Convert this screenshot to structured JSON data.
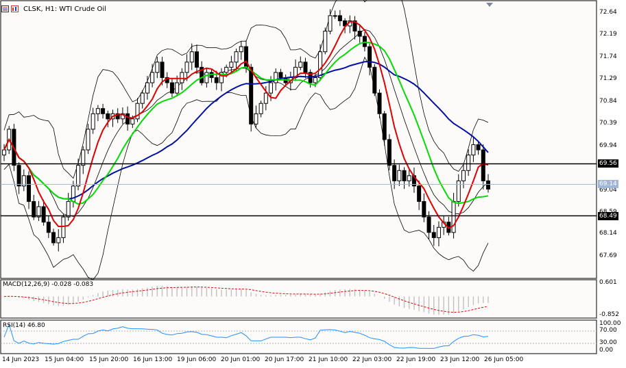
{
  "header": {
    "symbol": "CLSK",
    "timeframe": "H1",
    "instrument": "WTI Crude Oil",
    "title": "CLSK, H1:  WTI Crude Oil"
  },
  "icons": [
    "chart-window-icon",
    "properties-icon"
  ],
  "colors": {
    "up_candle": "#000000",
    "down_candle": "#000000",
    "ma_fast": "#e00000",
    "ma_mid": "#00dd00",
    "ma_slow": "#0010a0",
    "bollinger": "#000000",
    "macd_hist": "#c0c0c0",
    "macd_signal": "#e00000",
    "rsi": "#1e90ff",
    "current_price_line": "#7c9cc8",
    "level_line": "#000000"
  },
  "price_axis": {
    "labels": [
      "72.64",
      "72.19",
      "71.74",
      "71.29",
      "70.84",
      "70.39",
      "69.94",
      "69.04",
      "68.59",
      "68.14",
      "67.69"
    ],
    "level_upper": "69.56",
    "level_lower": "68.49",
    "current_price": "69.14"
  },
  "macd": {
    "title": "MACD(12,26,9) -0.028 -0.083",
    "axis_labels": [
      "0.601",
      "-0.852"
    ]
  },
  "rsi": {
    "title": "RSI(14) 46.80",
    "axis_labels": [
      "100.00",
      "70.00",
      "30.00",
      "0.00"
    ]
  },
  "time_axis": {
    "labels": [
      "14 Jun 2023",
      "15 Jun 04:00",
      "15 Jun 20:00",
      "16 Jun 13:00",
      "19 Jun 06:00",
      "20 Jun 01:00",
      "20 Jun 17:00",
      "21 Jun 10:00",
      "22 Jun 03:00",
      "22 Jun 19:00",
      "23 Jun 12:00",
      "26 Jun 05:00"
    ]
  },
  "chart_data": {
    "type": "candlestick",
    "ylim": [
      67.45,
      72.75
    ],
    "levels": [
      69.56,
      68.49
    ],
    "current_price": 69.14,
    "closes": [
      69.9,
      70.3,
      69.6,
      69.2,
      69.4,
      68.9,
      68.6,
      68.8,
      68.5,
      68.3,
      68.1,
      68.2,
      68.6,
      68.9,
      69.2,
      69.6,
      69.9,
      70.3,
      70.6,
      70.7,
      70.6,
      70.5,
      70.6,
      70.5,
      70.6,
      70.4,
      70.5,
      70.8,
      71.0,
      71.2,
      71.4,
      71.6,
      71.3,
      71.2,
      71.0,
      71.2,
      71.4,
      71.6,
      71.8,
      71.5,
      71.2,
      71.4,
      71.3,
      71.2,
      71.4,
      71.5,
      71.6,
      71.8,
      71.9,
      71.5,
      70.4,
      70.6,
      70.8,
      71.0,
      71.2,
      71.4,
      71.3,
      71.2,
      71.3,
      71.5,
      71.6,
      71.4,
      71.2,
      71.3,
      71.8,
      72.2,
      72.5,
      72.5,
      72.4,
      72.3,
      72.4,
      72.2,
      72.1,
      71.9,
      71.5,
      71.0,
      70.6,
      70.1,
      69.6,
      69.3,
      69.5,
      69.3,
      69.4,
      69.2,
      68.9,
      68.6,
      68.3,
      68.2,
      68.4,
      68.5,
      68.3,
      68.9,
      69.3,
      69.5,
      69.8,
      70.0,
      69.9,
      69.3,
      69.14
    ]
  }
}
